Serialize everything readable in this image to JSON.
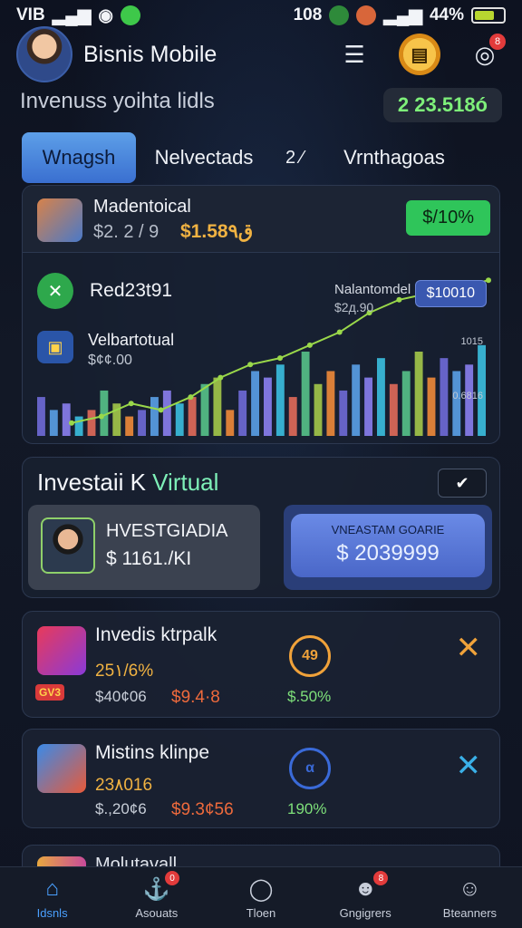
{
  "status_bar": {
    "carrier": "VIB",
    "time": "108",
    "battery": "44%"
  },
  "header": {
    "app_title": "Bisnis Mobile",
    "subtitle": "Invenuss yoihta lidls",
    "balance": "2 23.518ó",
    "notif_count": "8",
    "coin_glyph": "▤"
  },
  "tabs": [
    {
      "label": "Wnagsh"
    },
    {
      "label": "Nelvectads"
    },
    {
      "label": "2 ⁄"
    },
    {
      "label": "Vrnthagoas"
    }
  ],
  "chart_card": {
    "row_title": "Madentoical",
    "row_sub1": "$2. 2 / 9",
    "row_sub2": "$1.58ق٩",
    "pct_badge": "$/10%",
    "legend1": "Red23t91",
    "legend2": "Velbartotual",
    "legend2_sub": "$¢¢.00",
    "annotation": "Nalantomdel",
    "annotation_sub": "$2д.90",
    "annotation_pill": "$10010",
    "axis_top": "1015",
    "axis_bottom": "0.6816"
  },
  "chart_data": {
    "type": "bar",
    "bar_colors": [
      "#6f6ad8",
      "#5aa0e8",
      "#8a7ef0",
      "#3bbfe0",
      "#e26a5a",
      "#56c28a",
      "#a4c84a",
      "#f08a3a"
    ],
    "line_color": "#9ad84a",
    "values": [
      6,
      4,
      5,
      3,
      4,
      7,
      5,
      3,
      4,
      6,
      7,
      5,
      6,
      8,
      9,
      4,
      7,
      10,
      9,
      11,
      6,
      13,
      8,
      10,
      7,
      11,
      9,
      12,
      8,
      10,
      13,
      9,
      12,
      10,
      11,
      14
    ],
    "line_values": [
      2,
      3,
      5,
      4,
      6,
      9,
      11,
      12,
      14,
      16,
      19,
      21,
      22,
      23,
      24
    ],
    "ylim": [
      0,
      26
    ]
  },
  "invest_card": {
    "title_main": "Investaii Κ ",
    "title_accent": "Virtual",
    "chevron": "✔",
    "left_name": "HVESTGIADIA",
    "left_amount": "$ 1161./ΚΙ",
    "cta_title": "VNEASTAM GOARIE",
    "cta_amount": "$ 2039999"
  },
  "list": [
    {
      "title": "Invedis ktrpalk",
      "value": "25١/6%",
      "v1": "$40¢06",
      "v2": "$9.4·8",
      "pct": "$.50%",
      "ring_text": "49",
      "ring_color": "#f0a23a",
      "x_color": "#f0a23a",
      "ico_colors": [
        "#e83a5a",
        "#8a3ad8"
      ],
      "tag": "GV3"
    },
    {
      "title": "Mistins klinpe",
      "value": "23٨016",
      "v1": "$.,20¢6",
      "v2": "$9.3¢56",
      "pct": "190%",
      "ring_text": "α",
      "ring_color": "#3a6ad8",
      "x_color": "#3ab0e8",
      "ico_colors": [
        "#3a8ae8",
        "#e85a3a"
      ],
      "tag": ""
    }
  ],
  "partial_card": {
    "title": "Molutavall"
  },
  "bottom_nav": [
    {
      "label": "Idsnls",
      "icon": "⌂",
      "badge": ""
    },
    {
      "label": "Asouats",
      "icon": "⚓",
      "badge": "0"
    },
    {
      "label": "Tloen",
      "icon": "◯",
      "badge": ""
    },
    {
      "label": "Gngigrers",
      "icon": "☻",
      "badge": "8"
    },
    {
      "label": "Bteanners",
      "icon": "☺",
      "badge": ""
    }
  ]
}
